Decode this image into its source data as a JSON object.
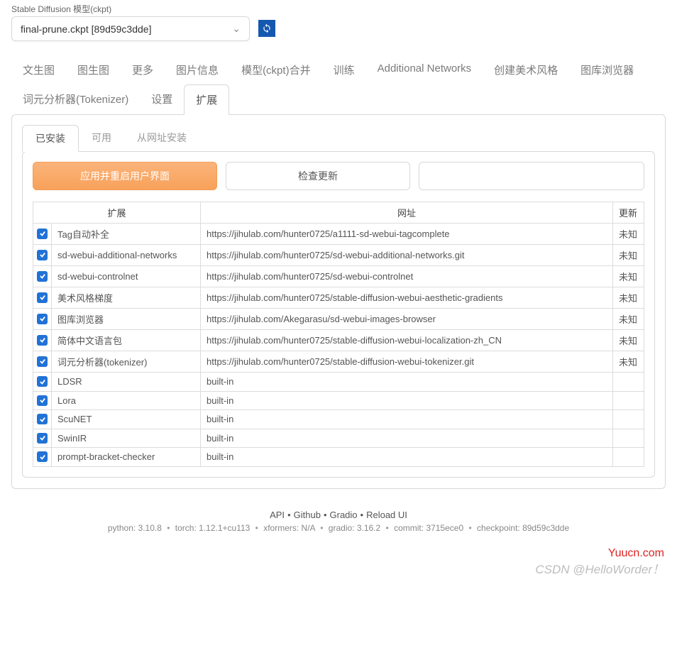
{
  "model": {
    "label": "Stable Diffusion 模型(ckpt)",
    "value": "final-prune.ckpt [89d59c3dde]"
  },
  "main_tabs": {
    "items": [
      "文生图",
      "图生图",
      "更多",
      "图片信息",
      "模型(ckpt)合并",
      "训练",
      "Additional Networks",
      "创建美术风格",
      "图库浏览器",
      "词元分析器(Tokenizer)",
      "设置",
      "扩展"
    ],
    "active": "扩展"
  },
  "sub_tabs": {
    "items": [
      "已安装",
      "可用",
      "从网址安装"
    ],
    "active": "已安装"
  },
  "buttons": {
    "apply_restart": "应用并重启用户界面",
    "check_updates": "检查更新"
  },
  "table": {
    "headers": {
      "ext": "扩展",
      "url": "网址",
      "update": "更新"
    },
    "rows": [
      {
        "name": "Tag自动补全",
        "url": "https://jihulab.com/hunter0725/a1111-sd-webui-tagcomplete",
        "update": "未知"
      },
      {
        "name": "sd-webui-additional-networks",
        "url": "https://jihulab.com/hunter0725/sd-webui-additional-networks.git",
        "update": "未知"
      },
      {
        "name": "sd-webui-controlnet",
        "url": "https://jihulab.com/hunter0725/sd-webui-controlnet",
        "update": "未知"
      },
      {
        "name": "美术风格梯度",
        "url": "https://jihulab.com/hunter0725/stable-diffusion-webui-aesthetic-gradients",
        "update": "未知"
      },
      {
        "name": "图库浏览器",
        "url": "https://jihulab.com/Akegarasu/sd-webui-images-browser",
        "update": "未知"
      },
      {
        "name": "简体中文语言包",
        "url": "https://jihulab.com/hunter0725/stable-diffusion-webui-localization-zh_CN",
        "update": "未知"
      },
      {
        "name": "词元分析器(tokenizer)",
        "url": "https://jihulab.com/hunter0725/stable-diffusion-webui-tokenizer.git",
        "update": "未知"
      },
      {
        "name": "LDSR",
        "url": "built-in",
        "update": ""
      },
      {
        "name": "Lora",
        "url": "built-in",
        "update": ""
      },
      {
        "name": "ScuNET",
        "url": "built-in",
        "update": ""
      },
      {
        "name": "SwinIR",
        "url": "built-in",
        "update": ""
      },
      {
        "name": "prompt-bracket-checker",
        "url": "built-in",
        "update": ""
      }
    ]
  },
  "footer": {
    "links": [
      "API",
      "Github",
      "Gradio",
      "Reload UI"
    ],
    "meta": {
      "python": "python: 3.10.8",
      "torch": "torch: 1.12.1+cu113",
      "xformers": "xformers: N/A",
      "gradio": "gradio: 3.16.2",
      "commit": "commit: 3715ece0",
      "checkpoint": "checkpoint: 89d59c3dde"
    }
  },
  "watermark": {
    "site": "Yuucn.com",
    "author": "CSDN @HelloWorder！"
  }
}
